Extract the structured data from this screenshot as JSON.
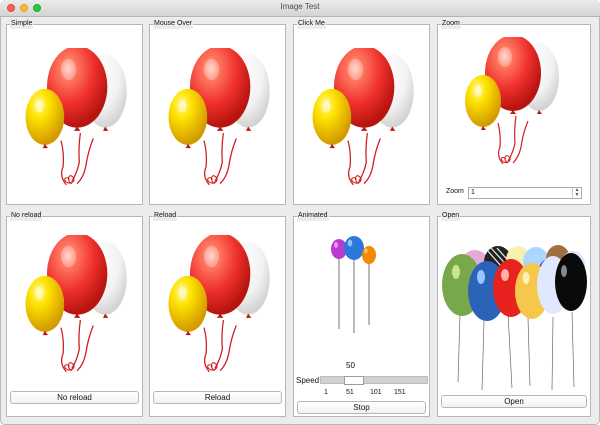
{
  "window": {
    "title": "Image Test"
  },
  "groups": {
    "simple": {
      "label": "Simple"
    },
    "mouse_over": {
      "label": "Mouse Over"
    },
    "click_me": {
      "label": "Click Me"
    },
    "zoom": {
      "label": "Zoom",
      "zoom_label": "Zoom",
      "zoom_value": "1"
    },
    "no_reload": {
      "label": "No reload",
      "button_label": "No reload"
    },
    "reload": {
      "label": "Reload",
      "button_label": "Reload"
    },
    "animated": {
      "label": "Animated",
      "speed_value": "50",
      "speed_label": "Speed",
      "ticks": [
        "1",
        "51",
        "101",
        "151"
      ],
      "stop_label": "Stop"
    },
    "open": {
      "label": "Open",
      "button_label": "Open"
    }
  },
  "colors": {
    "balloon_red": "#f0312e",
    "balloon_yellow": "#ffd400",
    "balloon_white": "#f2f2f2",
    "animated_purple": "#b93bd1",
    "animated_blue": "#2d79db",
    "animated_orange": "#f08a00"
  }
}
